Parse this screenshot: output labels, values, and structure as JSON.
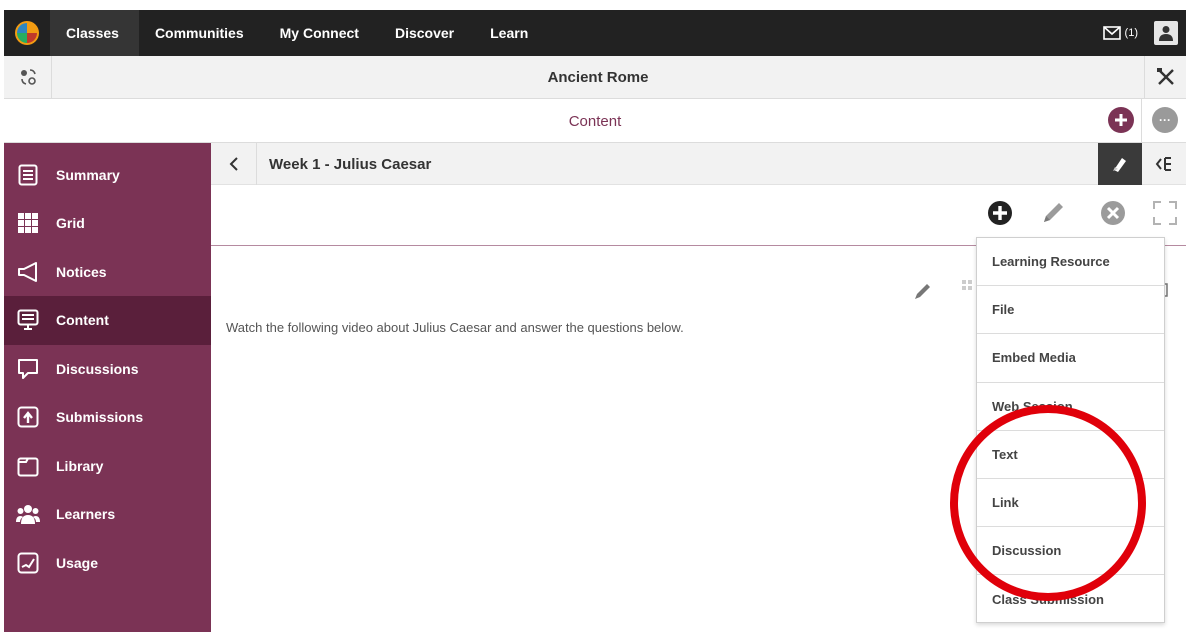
{
  "topnav": {
    "items": [
      {
        "label": "Classes",
        "active": true
      },
      {
        "label": "Communities",
        "active": false
      },
      {
        "label": "My Connect",
        "active": false
      },
      {
        "label": "Discover",
        "active": false
      },
      {
        "label": "Learn",
        "active": false
      }
    ],
    "mail_count": "(1)"
  },
  "classbar": {
    "title": "Ancient Rome"
  },
  "sectionbar": {
    "title": "Content"
  },
  "sidebar": {
    "items": [
      {
        "label": "Summary",
        "icon": "summary-icon"
      },
      {
        "label": "Grid",
        "icon": "grid-icon"
      },
      {
        "label": "Notices",
        "icon": "megaphone-icon"
      },
      {
        "label": "Content",
        "icon": "monitor-icon",
        "active": true
      },
      {
        "label": "Discussions",
        "icon": "chat-icon"
      },
      {
        "label": "Submissions",
        "icon": "upload-icon"
      },
      {
        "label": "Library",
        "icon": "folder-icon"
      },
      {
        "label": "Learners",
        "icon": "people-icon"
      },
      {
        "label": "Usage",
        "icon": "chart-icon"
      }
    ]
  },
  "folder": {
    "title": "Week 1 - Julius Caesar"
  },
  "content": {
    "text": "Watch the following video about Julius Caesar and answer the questions below."
  },
  "dropdown": {
    "items": [
      "Learning Resource",
      "File",
      "Embed Media",
      "Web Session",
      "Text",
      "Link",
      "Discussion",
      "Class Submission"
    ]
  },
  "colors": {
    "brand": "#7b3355",
    "brand_dark": "#5a1f3b",
    "nav": "#222222",
    "annotation": "#e0000a"
  }
}
